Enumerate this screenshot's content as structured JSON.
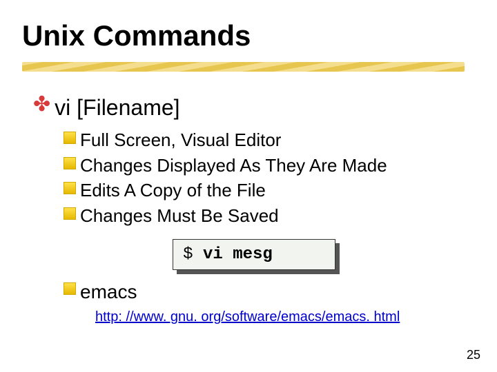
{
  "title": "Unix Commands",
  "item": {
    "command": "vi [Filename]",
    "details": [
      "Full Screen, Visual Editor",
      "Changes Displayed As They Are Made",
      "Edits A Copy of the File",
      "Changes Must Be Saved"
    ]
  },
  "codebox": {
    "prompt": "$",
    "command": "vi mesg"
  },
  "secondItem": {
    "label": "emacs",
    "link": "http: //www. gnu. org/software/emacs/emacs. html"
  },
  "pageNumber": "25"
}
